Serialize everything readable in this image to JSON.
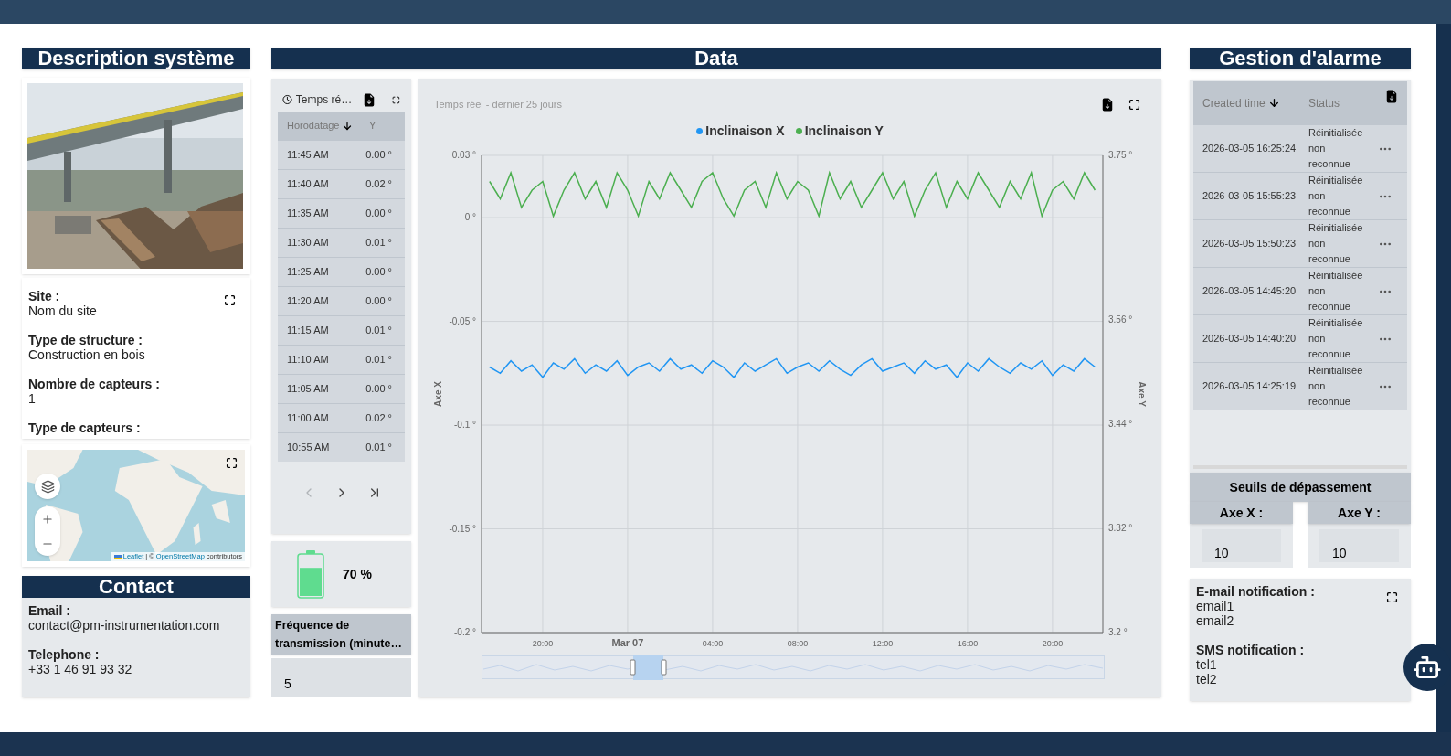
{
  "description": {
    "title": "Description système",
    "fields": [
      {
        "label": "Site :",
        "value": "Nom du site"
      },
      {
        "label": "Type de structure :",
        "value": "Construction en bois"
      },
      {
        "label": "Nombre de capteurs :",
        "value": "1"
      },
      {
        "label": "Type de capteurs :"
      }
    ],
    "map": {
      "attribution": [
        {
          "text": "Leaflet",
          "link": true
        },
        {
          "text": "| ©",
          "link": false
        },
        {
          "text": "OpenStreetMap",
          "link": true
        },
        {
          "text": "contributors",
          "link": false
        }
      ]
    }
  },
  "contact": {
    "title": "Contact",
    "fields": [
      {
        "label": "Email :",
        "value": "contact@pm-instrumentation.com"
      },
      {
        "label": "Telephone :",
        "value": "+33 1 46 91 93 32"
      }
    ]
  },
  "data": {
    "title": "Data",
    "table": {
      "period": "Temps ré…",
      "columns": [
        {
          "label": "Horodatage",
          "sorted": true
        },
        {
          "label": "Y",
          "sorted": false
        }
      ],
      "rows": [
        [
          "11:45 AM",
          "0.00 °"
        ],
        [
          "11:40 AM",
          "0.02 °"
        ],
        [
          "11:35 AM",
          "0.00 °"
        ],
        [
          "11:30 AM",
          "0.01 °"
        ],
        [
          "11:25 AM",
          "0.00 °"
        ],
        [
          "11:20 AM",
          "0.00 °"
        ],
        [
          "11:15 AM",
          "0.01 °"
        ],
        [
          "11:10 AM",
          "0.01 °"
        ],
        [
          "11:05 AM",
          "0.00 °"
        ],
        [
          "11:00 AM",
          "0.02 °"
        ],
        [
          "10:55 AM",
          "0.01 °"
        ]
      ],
      "pagination": [
        {
          "kind": "prev",
          "disabled": true
        },
        {
          "kind": "next",
          "disabled": false
        },
        {
          "kind": "last",
          "disabled": false
        }
      ]
    },
    "battery": {
      "level": 0.7,
      "reading": "70 %"
    },
    "frequency": {
      "label": "Fréquence de transmission (minute…",
      "value": "5"
    },
    "chart_data": {
      "type": "line",
      "title": "Temps réel - dernier 25 jours",
      "ylabel": "Axe X",
      "y2label": "Axe Y",
      "categories": [
        null,
        null,
        null,
        null,
        null,
        "20:00",
        null,
        null,
        null,
        null,
        null,
        null,
        null,
        "Mar 07",
        null,
        null,
        null,
        null,
        null,
        null,
        null,
        "04:00",
        null,
        null,
        null,
        null,
        null,
        null,
        null,
        "08:00",
        null,
        null,
        null,
        null,
        null,
        null,
        null,
        "12:00",
        null,
        null,
        null,
        null,
        null,
        null,
        null,
        "16:00",
        null,
        null,
        null,
        null,
        null,
        null,
        null,
        "20:00",
        null,
        null,
        null,
        null
      ],
      "series": [
        {
          "name": "Inclinaison X",
          "color": "#2196f3",
          "values": [
            -0.072,
            -0.075,
            -0.069,
            -0.074,
            -0.071,
            -0.077,
            -0.07,
            -0.073,
            -0.068,
            -0.075,
            -0.071,
            -0.074,
            -0.069,
            -0.076,
            -0.072,
            -0.07,
            -0.074,
            -0.068,
            -0.073,
            -0.071,
            -0.075,
            -0.069,
            -0.072,
            -0.077,
            -0.07,
            -0.074,
            -0.071,
            -0.068,
            -0.075,
            -0.072,
            -0.07,
            -0.074,
            -0.069,
            -0.073,
            -0.076,
            -0.071,
            -0.068,
            -0.074,
            -0.072,
            -0.07,
            -0.075,
            -0.069,
            -0.073,
            -0.071,
            -0.077,
            -0.07,
            -0.074,
            -0.068,
            -0.072,
            -0.075,
            -0.07,
            -0.073,
            -0.069,
            -0.076,
            -0.071,
            -0.074,
            -0.068,
            -0.072
          ]
        },
        {
          "name": "Inclinaison Y",
          "color": "#4caf50",
          "axis": "y2",
          "values": [
            3.72,
            3.7,
            3.73,
            3.69,
            3.71,
            3.72,
            3.68,
            3.71,
            3.73,
            3.7,
            3.72,
            3.69,
            3.73,
            3.71,
            3.68,
            3.72,
            3.7,
            3.73,
            3.71,
            3.69,
            3.72,
            3.73,
            3.7,
            3.68,
            3.71,
            3.72,
            3.69,
            3.73,
            3.7,
            3.72,
            3.71,
            3.68,
            3.73,
            3.7,
            3.72,
            3.69,
            3.71,
            3.73,
            3.7,
            3.72,
            3.68,
            3.71,
            3.73,
            3.69,
            3.72,
            3.7,
            3.73,
            3.71,
            3.69,
            3.72,
            3.7,
            3.73,
            3.68,
            3.71,
            3.72,
            3.7,
            3.73,
            3.71
          ]
        }
      ],
      "grid": true,
      "ylim": [
        -0.2,
        0.03
      ],
      "y2lim": [
        3.2,
        3.75
      ],
      "yticks": [
        {
          "value": 0.03,
          "label": "0.03 °"
        },
        {
          "value": 0,
          "label": "0 °"
        },
        {
          "value": -0.05,
          "label": "-0.05 °"
        },
        {
          "value": -0.1,
          "label": "-0.1 °"
        },
        {
          "value": -0.15,
          "label": "-0.15 °"
        },
        {
          "value": -0.2,
          "label": "-0.2 °"
        }
      ],
      "y2ticks": [
        {
          "value": 3.75,
          "label": "3.75 °"
        },
        {
          "value": 3.56,
          "label": "3.56 °"
        },
        {
          "value": 3.44,
          "label": "3.44 °"
        },
        {
          "value": 3.32,
          "label": "3.32 °"
        },
        {
          "value": 3.2,
          "label": "3.2 °"
        }
      ]
    }
  },
  "alarms": {
    "title": "Gestion d'alarme",
    "columns": [
      {
        "label": "Created time",
        "sorted": true
      },
      {
        "label": "Status",
        "sorted": false
      }
    ],
    "rows": [
      {
        "time": "2026-03-05 16:25:24",
        "status": "Réinitialisée non reconnue"
      },
      {
        "time": "2026-03-05 15:55:23",
        "status": "Réinitialisée non reconnue"
      },
      {
        "time": "2026-03-05 15:50:23",
        "status": "Réinitialisée non reconnue"
      },
      {
        "time": "2026-03-05 14:45:20",
        "status": "Réinitialisée non reconnue"
      },
      {
        "time": "2026-03-05 14:40:20",
        "status": "Réinitialisée non reconnue"
      },
      {
        "time": "2026-03-05 14:25:19",
        "status": "Réinitialisée non reconnue"
      }
    ]
  },
  "thresholds": {
    "title": "Seuils de dépassement",
    "axes": [
      {
        "label": "Axe X :",
        "value": "10"
      },
      {
        "label": "Axe Y :",
        "value": "10"
      }
    ]
  },
  "notifications": [
    {
      "label": "E-mail notification :",
      "values": [
        "email1",
        "email2"
      ]
    },
    {
      "label": "SMS notification :",
      "values": [
        "tel1",
        "tel2"
      ]
    }
  ]
}
